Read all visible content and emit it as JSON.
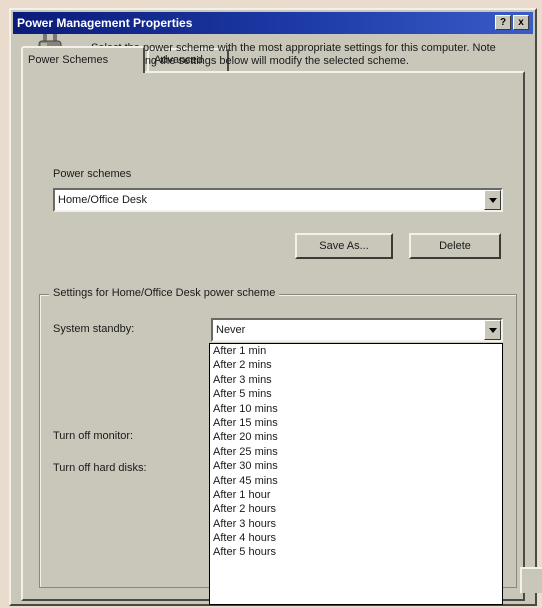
{
  "window": {
    "title": "Power Management Properties",
    "help_button": "?",
    "close_button": "x"
  },
  "tabs": [
    {
      "label": "Power Schemes",
      "active": true
    },
    {
      "label": "Advanced",
      "active": false
    }
  ],
  "description": "Select the power scheme with the most appropriate settings for this computer. Note that changing the settings below will modify the selected scheme.",
  "power_schemes": {
    "label": "Power schemes",
    "value": "Home/Office Desk",
    "save_as_label": "Save As...",
    "delete_label": "Delete"
  },
  "settings": {
    "group_title": "Settings for Home/Office Desk power scheme",
    "system_standby_label": "System standby:",
    "system_standby_value": "Never",
    "turn_off_monitor_label": "Turn off monitor:",
    "turn_off_hard_disks_label": "Turn off hard disks:"
  },
  "dropdown_options": [
    "After 1 min",
    "After 2 mins",
    "After 3 mins",
    "After 5 mins",
    "After 10 mins",
    "After 15 mins",
    "After 20 mins",
    "After 25 mins",
    "After 30 mins",
    "After 45 mins",
    "After 1 hour",
    "After 2 hours",
    "After 3 hours",
    "After 4 hours",
    "After 5 hours"
  ],
  "colors": {
    "title_bar_start": "#0a1b7a",
    "title_bar_end": "#3a5cc8",
    "face": "#c9c6ba"
  }
}
